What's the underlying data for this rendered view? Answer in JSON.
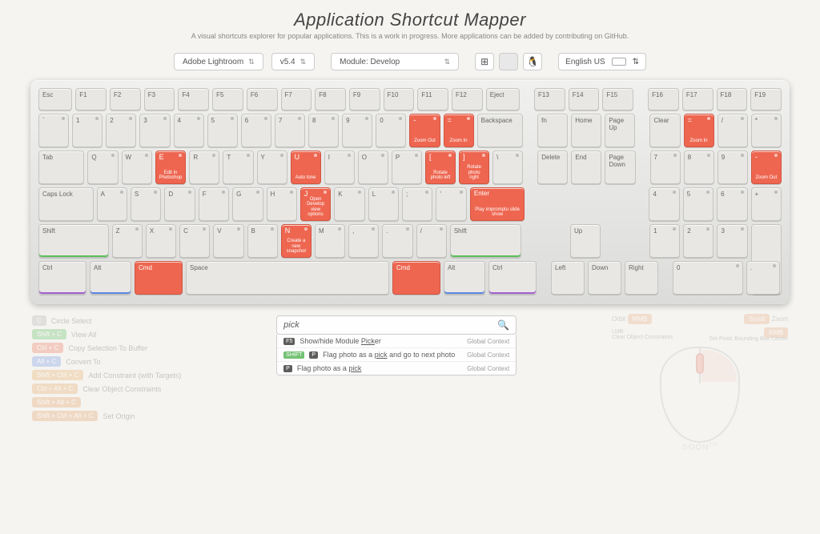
{
  "header": {
    "title": "Application Shortcut Mapper",
    "subtitle": "A visual shortcuts explorer for popular applications. This is a work in progress. More applications can be added by contributing on GitHub."
  },
  "controls": {
    "app": "Adobe Lightroom",
    "version": "v5.4",
    "context": "Module: Develop",
    "os": [
      "windows",
      "mac",
      "linux"
    ],
    "os_active": "mac",
    "language": "English US"
  },
  "rowF": {
    "esc": "Esc",
    "f1": "F1",
    "f2": "F2",
    "f3": "F3",
    "f4": "F4",
    "f5": "F5",
    "f6": "F6",
    "f7": "F7",
    "f8": "F8",
    "f9": "F9",
    "f10": "F10",
    "f11": "F11",
    "f12": "F12",
    "eject": "Eject",
    "f13": "F13",
    "f14": "F14",
    "f15": "F15",
    "f16": "F16",
    "f17": "F17",
    "f18": "F18",
    "f19": "F19"
  },
  "rowNum": {
    "backtick": "`",
    "n1": "1",
    "n2": "2",
    "n3": "3",
    "n4": "4",
    "n5": "5",
    "n6": "6",
    "n7": "7",
    "n8": "8",
    "n9": "9",
    "n0": "0",
    "minus": "-",
    "minus_desc": "Zoom Out",
    "equals": "=",
    "equals_desc": "Zoom In",
    "backspace": "Backspace",
    "fn": "fn",
    "home": "Home",
    "pgup": "Page Up",
    "clear": "Clear",
    "npEq": "=",
    "npEq_desc": "Zoom In",
    "npSlash": "/",
    "npStar": "*"
  },
  "rowQ": {
    "tab": "Tab",
    "q": "Q",
    "w": "W",
    "e": "E",
    "e_desc": "Edit in Photoshop",
    "r": "R",
    "t": "T",
    "y": "Y",
    "u": "U",
    "u_desc": "Auto tone",
    "i": "I",
    "o": "O",
    "p": "P",
    "lbr": "[",
    "lbr_desc": "Rotate photo left",
    "rbr": "]",
    "rbr_desc": "Rotate photo right",
    "bslash": "\\",
    "del": "Delete",
    "end": "End",
    "pgdn": "Page Down",
    "np7": "7",
    "np8": "8",
    "np9": "9",
    "npMinus": "-",
    "npMinus_desc": "Zoom Out"
  },
  "rowA": {
    "caps": "Caps Lock",
    "a": "A",
    "s": "S",
    "d": "D",
    "f": "F",
    "g": "G",
    "h": "H",
    "j": "J",
    "j_desc": "Open Develop view options",
    "k": "K",
    "l": "L",
    "semi": ";",
    "quote": "'",
    "enter": "Enter",
    "enter_desc": "Play impromptu slide show",
    "np4": "4",
    "np5": "5",
    "np6": "6",
    "npPlus": "+"
  },
  "rowZ": {
    "lshift": "Shift",
    "z": "Z",
    "x": "X",
    "c": "C",
    "v": "V",
    "b": "B",
    "n": "N",
    "n_desc": "Create a new snapshot",
    "m": "M",
    "comma": ",",
    "dot": ".",
    "slash": "/",
    "rshift": "Shift",
    "up": "Up",
    "np1": "1",
    "np2": "2",
    "np3": "3"
  },
  "rowMod": {
    "lctrl": "Ctrl",
    "lalt": "Alt",
    "lcmd": "Cmd",
    "space": "Space",
    "rcmd": "Cmd",
    "ralt": "Alt",
    "rctrl": "Ctrl",
    "left": "Left",
    "down": "Down",
    "right": "Right",
    "np0": "0",
    "npDot": ".",
    "npEnter": ""
  },
  "legend": {
    "i0": {
      "badge": "C",
      "label": "Circle Select"
    },
    "i1": {
      "badge": "Shift + C",
      "label": "View All"
    },
    "i2": {
      "badge": "Ctrl + C",
      "label": "Copy Selection To Buffer"
    },
    "i3": {
      "badge": "Alt + C",
      "label": "Convert To"
    },
    "i4": {
      "badge": "Shift + Ctrl + C",
      "label": "Add Constraint (with Targets)"
    },
    "i5": {
      "badge": "Ctrl + Alt + C",
      "label": "Clear Object Constraints"
    },
    "i6": {
      "badge": "Shift + Alt + C",
      "label": ""
    },
    "i7": {
      "badge": "Shift + Ctrl + Alt + C",
      "label": "Set Origin"
    }
  },
  "search": {
    "value": "pick",
    "r0": {
      "k": "F5",
      "txt": "Show/hide Module Picker",
      "ctx": "Global Context"
    },
    "r1": {
      "k1": "SHIFT",
      "k2": "P",
      "txt": "Flag photo as a pick and go to next photo",
      "ctx": "Global Context"
    },
    "r2": {
      "k": "P",
      "txt": "Flag photo as a pick",
      "ctx": "Global Context"
    }
  },
  "mouse": {
    "orbit": "Orbit",
    "mmb": "MMB",
    "scroll": "Scroll",
    "zoom": "Zoom",
    "lmb": "LMB",
    "lmb_desc": "Clear Object Constraints",
    "rmb": "RMB",
    "rmb_desc": "Set Pivot: Bounding Box Center",
    "soon": "SOON",
    "tm": "TM"
  }
}
